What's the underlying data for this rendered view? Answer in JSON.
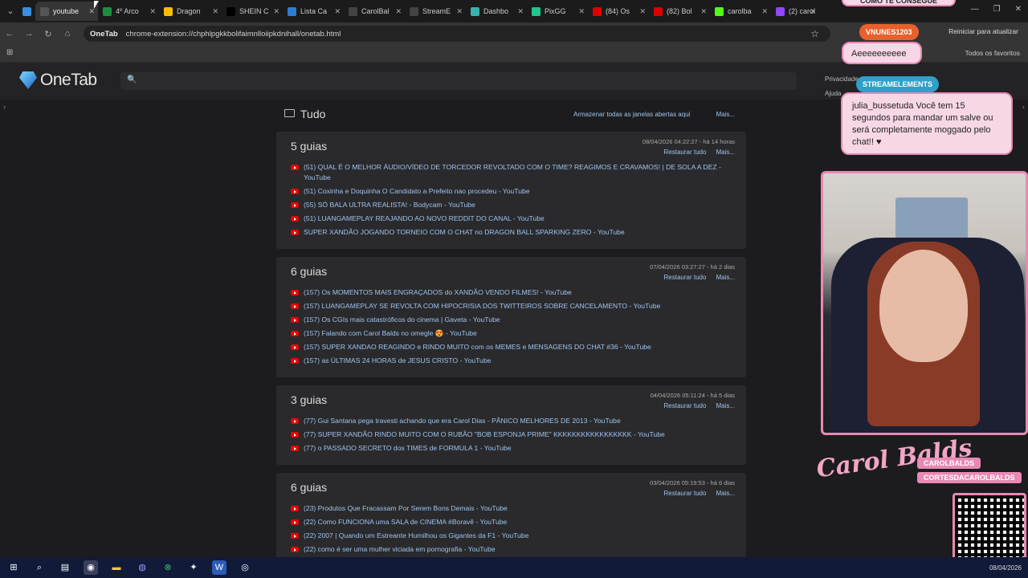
{
  "browser": {
    "tabs": [
      {
        "label": "",
        "color": "#3a8de0"
      },
      {
        "label": "youtube",
        "color": "#555555"
      },
      {
        "label": "4º Arco",
        "color": "#1e8e3e"
      },
      {
        "label": "Dragon",
        "color": "#fbbc05"
      },
      {
        "label": "SHEIN C",
        "color": "#000000"
      },
      {
        "label": "Lista Ca",
        "color": "#2f7dd1"
      },
      {
        "label": "CarolBal",
        "color": "#444444"
      },
      {
        "label": "StreamE",
        "color": "#444444"
      },
      {
        "label": "Dashbo",
        "color": "#38b2ac"
      },
      {
        "label": "PixGG",
        "color": "#22c38e"
      },
      {
        "label": "(84) Os",
        "color": "#e00000"
      },
      {
        "label": "(82) Bol",
        "color": "#e00000"
      },
      {
        "label": "carolba",
        "color": "#53fc18"
      },
      {
        "label": "(2) carol",
        "color": "#9146ff"
      }
    ],
    "active_tab_index": 1,
    "omnibox_chip": "OneTab",
    "url": "chrome-extension://chphlpgkkbolifaimnlloiipkdnihall/onetab.html",
    "update_label": "Reiniciar para atualizar",
    "all_bookmarks": "Todos os favoritos"
  },
  "onetab": {
    "logo": "OneTab",
    "header_links": [
      "Privacidade em primeiro lugar",
      "Ajuda"
    ],
    "section_title": "Tudo",
    "store_all": "Armazenar todas as janelas abertas aqui",
    "more": "Mais...",
    "restore_all": "Restaurar tudo",
    "groups": [
      {
        "title": "5 guias",
        "date": "08/04/2026 04:22:27 - há 14 horas",
        "items": [
          "(51) QUAL É O MELHOR ÁUDIO/VÍDEO DE TORCEDOR REVOLTADO COM O TIME? REAGIMOS E CRAVAMOS! | DE SOLA A DEZ - YouTube",
          "(51) Coxinha e Doquinha O Candidato a Prefeito nao procedeu - YouTube",
          "(55) SÓ BALA ULTRA REALISTA! - Bodycam - YouTube",
          "(51) LUANGAMEPLAY REAJANDO AO NOVO REDDIT DO CANAL - YouTube",
          "SUPER XANDÃO JOGANDO TORNEIO COM O CHAT no DRAGON BALL SPARKING ZERO - YouTube"
        ]
      },
      {
        "title": "6 guias",
        "date": "07/04/2026 03:27:27 - há 2 dias",
        "items": [
          "(157) Os MOMENTOS MAIS ENGRAÇADOS do XANDÃO VENDO FILMES! - YouTube",
          "(157) LUANGAMEPLAY SE REVOLTA COM HIPOCRISIA DOS TWITTEIROS SOBRE CANCELAMENTO - YouTube",
          "(157) Os CGIs mais catastróficos do cinema | Gaveta - YouTube",
          "(157) Falando com Carol Balds no omegle 😍 - YouTube",
          "(157) SUPER XANDAO REAGINDO e RINDO MUITO com os MEMES e MENSAGENS DO CHAT #36 - YouTube",
          "(157) as ÚLTIMAS 24 HORAS de JESUS CRISTO - YouTube"
        ]
      },
      {
        "title": "3 guias",
        "date": "04/04/2026 05:11:24 - há 5 dias",
        "items": [
          "(77) Gui Santana pega travesti achando que era Carol Dias - PÂNICO MELHORES DE 2013 - YouTube",
          "(77) SUPER XANDÃO RINDO MUITO COM O RUBÃO \"BOB ESPONJA PRIME\" KKKKKKKKKKKKKKKKK - YouTube",
          "(77) o PASSADO SECRETO dos TIMES de FORMULA 1 - YouTube"
        ]
      },
      {
        "title": "6 guias",
        "date": "03/04/2026 05:19:53 - há 6 dias",
        "items": [
          "(23) Produtos Que Fracassam Por Serem Bons Demais - YouTube",
          "(22) Como FUNCIONA uma SALA de CINEMA #Boravê - YouTube",
          "(22) 2007 | Quando um Estreante Humilhou os Gigantes da F1 - YouTube",
          "(22) como é ser uma mulher viciada em pornografia - YouTube"
        ]
      }
    ]
  },
  "overlay": {
    "top_bubble": "COMO TE CONSEGUE",
    "user_tag": "VNUNES1203",
    "user_msg": "Aeeeeeeeeee",
    "bot_tag": "STREAMELEMENTS",
    "bot_msg": "julia_bussetuda Você tem 15 segundos para mandar um salve ou será completamente moggado pelo chat!! ♥",
    "brand_sig": "Carol Balds",
    "handle_x": "CAROLBALDS",
    "handle_yt": "CORTESDACAROLBALDS"
  },
  "taskbar": {
    "date": "08/04/2026"
  }
}
